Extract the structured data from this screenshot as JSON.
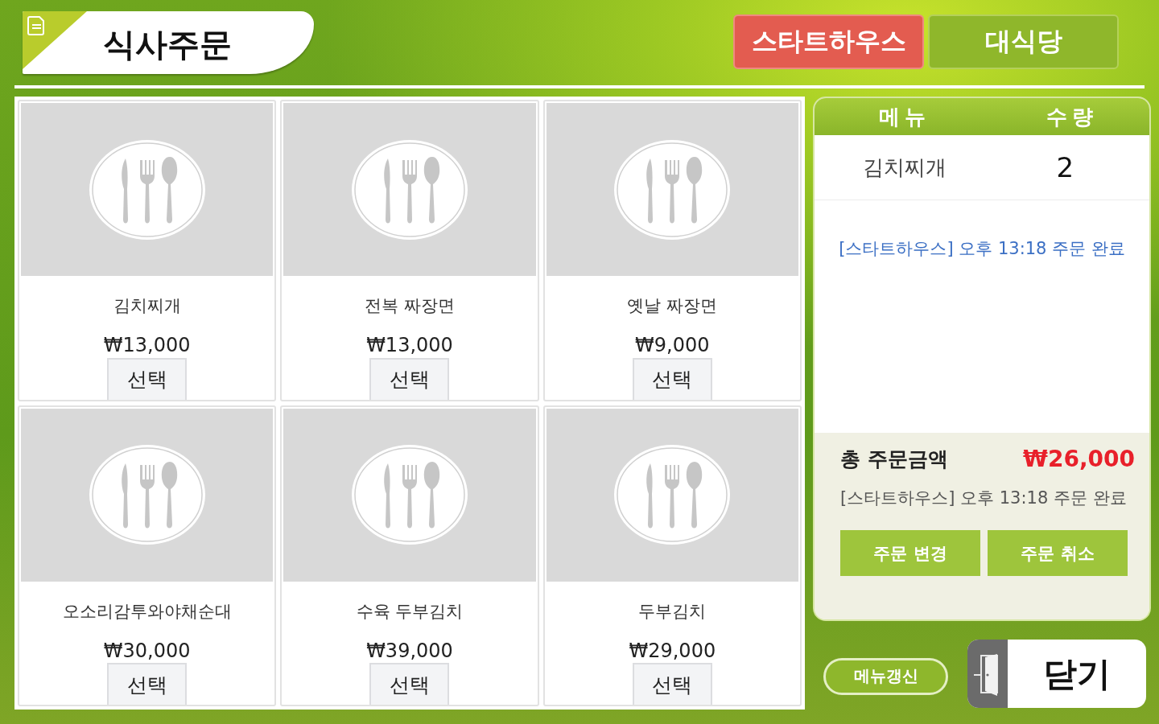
{
  "header": {
    "title": "식사주문"
  },
  "tabs": [
    {
      "label": "스타트하우스",
      "selected": true
    },
    {
      "label": "대식당",
      "selected": false
    }
  ],
  "menu_items": [
    {
      "name": "김치찌개",
      "price": "₩13,000",
      "button": "선택"
    },
    {
      "name": "전복 짜장면",
      "price": "₩13,000",
      "button": "선택"
    },
    {
      "name": "옛날 짜장면",
      "price": "₩9,000",
      "button": "선택"
    },
    {
      "name": "오소리감투와야채순대",
      "price": "₩30,000",
      "button": "선택"
    },
    {
      "name": "수육 두부김치",
      "price": "₩39,000",
      "button": "선택"
    },
    {
      "name": "두부김치",
      "price": "₩29,000",
      "button": "선택"
    }
  ],
  "order_panel": {
    "columns": [
      "메뉴",
      "수량"
    ],
    "items": [
      {
        "name": "김치찌개",
        "quantity": "2"
      }
    ],
    "status_message": "[스타트하우스] 오후 13:18 주문 완료",
    "total_label": "총 주문금액",
    "total_amount": "₩26,000",
    "summary_status": "[스타트하우스] 오후 13:18 주문 완료",
    "buttons": [
      "주문 변경",
      "주문 취소"
    ]
  },
  "refresh_button": "메뉴갱신",
  "close_button": "닫기"
}
